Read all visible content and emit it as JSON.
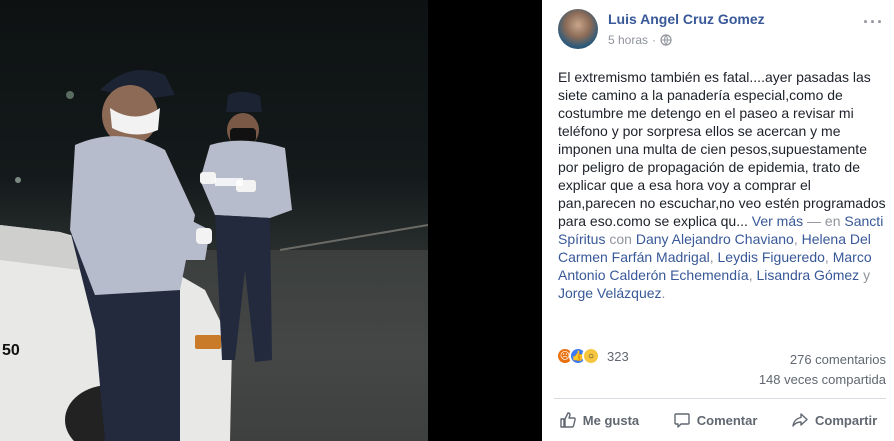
{
  "post": {
    "author": "Luis Angel Cruz Gomez",
    "time": "5 horas",
    "separator": "·",
    "privacy_icon": "globe-icon",
    "more_icon": "more-dots-icon",
    "text_body": "El extremismo también es fatal....ayer pasadas las siete camino a la panadería especial,como de costumbre me detengo en el paseo a revisar mi teléfono y por sorpresa ellos se acercan y me imponen una multa de cien pesos,supuestamente por peligro de propagación de epidemia, trato de explicar que a esa hora voy a comprar el pan,parecen no escuchar,no veo estén programados para eso.como se explica qu...",
    "see_more": "Ver más",
    "dash_en": "— en",
    "location": "Sancti Spíritus",
    "with_label": "con",
    "tagged": [
      "Dany Alejandro Chaviano",
      "Helena Del Carmen Farfán Madrigal",
      "Leydis Figueredo",
      "Marco Antonio Calderón Echemendía",
      "Lisandra Gómez"
    ],
    "and_label": "y",
    "last_tagged": "Jorge Velázquez",
    "end_period": "."
  },
  "stats": {
    "reaction_icons": [
      "angry-icon",
      "like-icon",
      "wow-icon"
    ],
    "reactions": "323",
    "comments": "276 comentarios",
    "shares": "148 veces compartida"
  },
  "actions": {
    "like": "Me gusta",
    "comment": "Comentar",
    "share": "Compartir"
  },
  "colors": {
    "link": "#385898",
    "text": "#1d2129",
    "muted": "#90949c"
  },
  "photo": {
    "car_number": "50"
  }
}
